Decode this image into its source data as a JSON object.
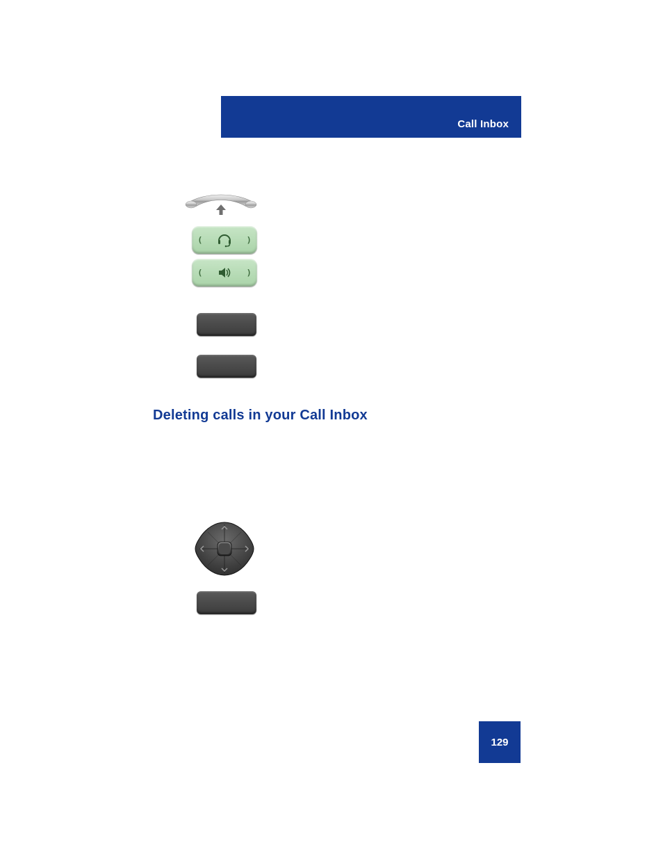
{
  "header": {
    "title": "Call Inbox"
  },
  "page": {
    "number": "129"
  },
  "section": {
    "heading": "Deleting calls in your Call Inbox"
  },
  "keys": {
    "handset": {
      "name": "handset-hookswitch"
    },
    "headset": {
      "name": "headset-key",
      "caps": {
        "left": "(",
        "right": ")"
      }
    },
    "handsfree": {
      "name": "handsfree-speaker-key",
      "caps": {
        "left": "(",
        "right": ")"
      }
    },
    "softkey1": {
      "name": "context-softkey"
    },
    "softkey2": {
      "name": "context-softkey"
    },
    "softkey3": {
      "name": "context-softkey"
    },
    "dpad": {
      "name": "navigation-key-cluster"
    }
  }
}
